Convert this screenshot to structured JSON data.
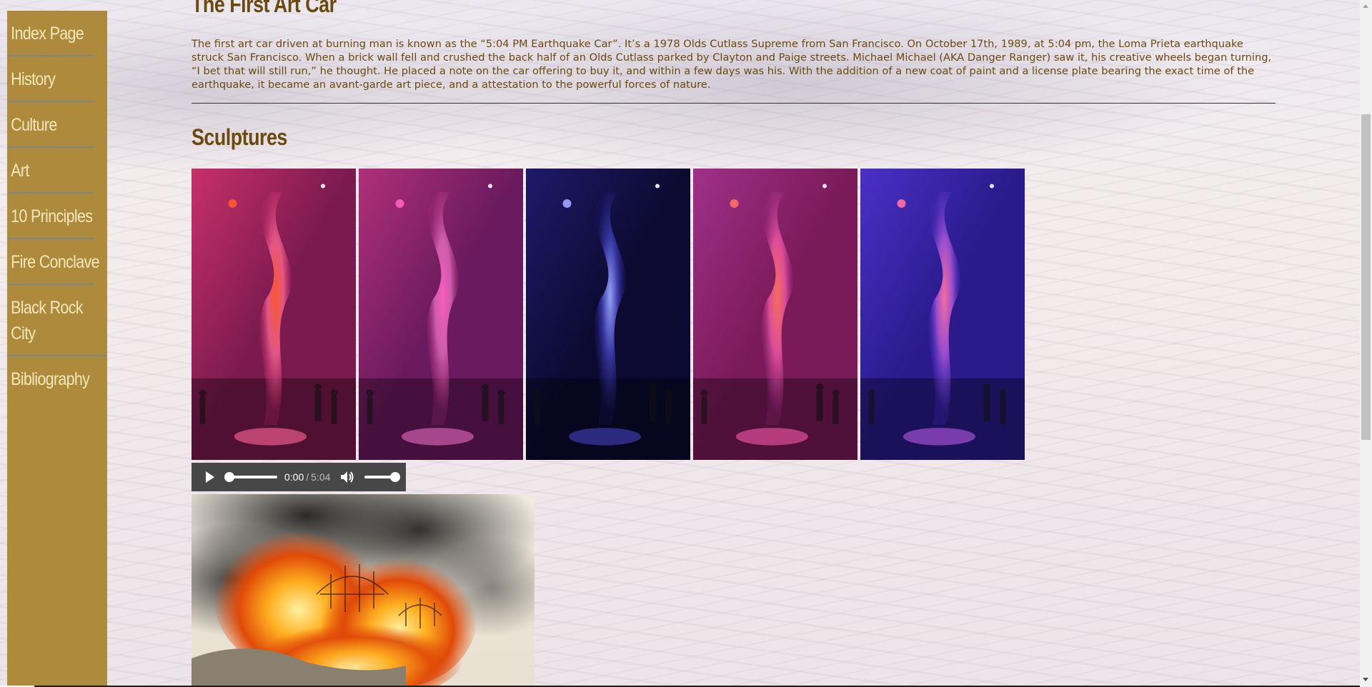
{
  "sidebar": {
    "items": [
      {
        "label": "Index Page"
      },
      {
        "label": "History"
      },
      {
        "label": "Culture"
      },
      {
        "label": "Art"
      },
      {
        "label": "10 Principles"
      },
      {
        "label": "Fire Conclave"
      },
      {
        "label": "Black Rock City"
      },
      {
        "label": "Bibliography"
      }
    ]
  },
  "main": {
    "first_art_car": {
      "title": "The First Art Car",
      "text": "The first art car driven at burning man is known as the “5:04 PM Earthquake Car”. It’s a 1978 Olds Cutlass Supreme from San Francisco. On October 17th, 1989, at 5:04 pm, the Loma Prieta earthquake struck San Francisco. When a brick wall fell and crushed the back half of an Olds Cutlass parked by Clayton and Paige streets. Michael Michael (AKA Danger Ranger) saw it, his creative wheels began turning, “I bet that will still run,” he thought. He placed a note on the car offering to buy it, and within a few days was his. With the addition of a new coat of paint and a license plate bearing the exact time of the earthquake, it became an avant-garde art piece, and a attestation to the powerful forces of nature."
    },
    "sculptures": {
      "title": "Sculptures",
      "photos": [
        {
          "palette": [
            "#7a1a4e",
            "#c8306a",
            "#e85a8a",
            "#ff5a2a"
          ]
        },
        {
          "palette": [
            "#6a1a5e",
            "#b0307a",
            "#d060b0",
            "#ff60c0"
          ]
        },
        {
          "palette": [
            "#0c0a30",
            "#1e1a6a",
            "#3a3aa8",
            "#9aa8ff"
          ]
        },
        {
          "palette": [
            "#7a1a58",
            "#a0308a",
            "#e0509a",
            "#ff7060"
          ]
        },
        {
          "palette": [
            "#2a1a8a",
            "#4a30c8",
            "#a050d0",
            "#ff70a0"
          ]
        }
      ]
    },
    "audio": {
      "current_time": "0:00",
      "separator": "/",
      "duration": "5:04"
    }
  },
  "colors": {
    "sidebar_bg": "#ad8a3c",
    "sidebar_text": "#f5e7b8",
    "heading": "#6b4a10",
    "audio_bg": "#474747"
  }
}
